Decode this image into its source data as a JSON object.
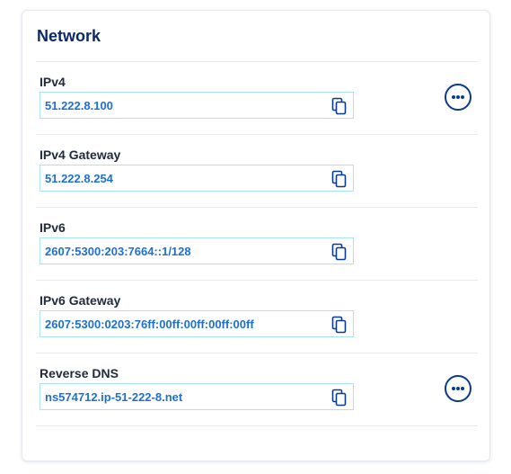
{
  "card": {
    "title": "Network",
    "rows": [
      {
        "label": "IPv4",
        "value": "51.222.8.100",
        "has_menu": true
      },
      {
        "label": "IPv4 Gateway",
        "value": "51.222.8.254",
        "has_menu": false
      },
      {
        "label": "IPv6",
        "value": "2607:5300:203:7664::1/128",
        "has_menu": false
      },
      {
        "label": "IPv6 Gateway",
        "value": "2607:5300:0203:76ff:00ff:00ff:00ff:00ff",
        "has_menu": false
      },
      {
        "label": "Reverse DNS",
        "value": "ns574712.ip-51-222-8.net",
        "has_menu": true
      }
    ]
  },
  "icons": {
    "copy": "copy-icon",
    "more": "more-options-icon"
  },
  "colors": {
    "title": "#0a2a66",
    "value_text": "#1f6fd1",
    "input_border": "#a8e3ee",
    "icon": "#0a3a8c"
  }
}
